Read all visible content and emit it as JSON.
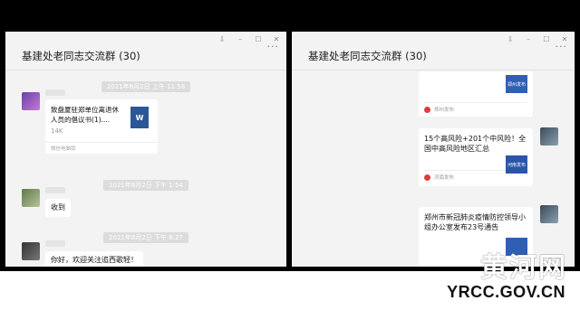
{
  "left_window": {
    "title": "基建处老同志交流群 (30)",
    "more": "···",
    "controls": [
      "⇩",
      "–",
      "☐",
      "✕"
    ],
    "messages": [
      {
        "timestamp": "2021年8月2日 上午 11:58"
      },
      {
        "file_name": "致盘厦驻郑单位离退休人员的倡议书(1)....",
        "file_size": "14K",
        "file_source": "微信电脑版",
        "file_icon_label": "W"
      },
      {
        "timestamp": "2021年8月2日 下午 1:54"
      },
      {
        "text": "收到"
      },
      {
        "timestamp": "2021年8月2日 下午 6:27"
      },
      {
        "text": "你好，欢迎关注追西歌轻！"
      }
    ]
  },
  "right_window": {
    "title": "基建处老同志交流群 (30)",
    "more": "···",
    "controls": [
      "⇩",
      "–",
      "☐",
      "✕"
    ],
    "cards": [
      {
        "title": "",
        "source": "郑州发布",
        "thumb": "郑州发布"
      },
      {
        "title": "15个高风险+201个中风险！全国中高风险地区汇总",
        "source": "河南发布",
        "thumb": "河南发布"
      },
      {
        "title": "郑州市新冠肺炎疫情防控领导小组办公室发布23号通告",
        "source": "",
        "thumb": ""
      }
    ]
  },
  "watermark": {
    "logo_text": "黄河网",
    "url": "YRCC.GOV.CN"
  }
}
